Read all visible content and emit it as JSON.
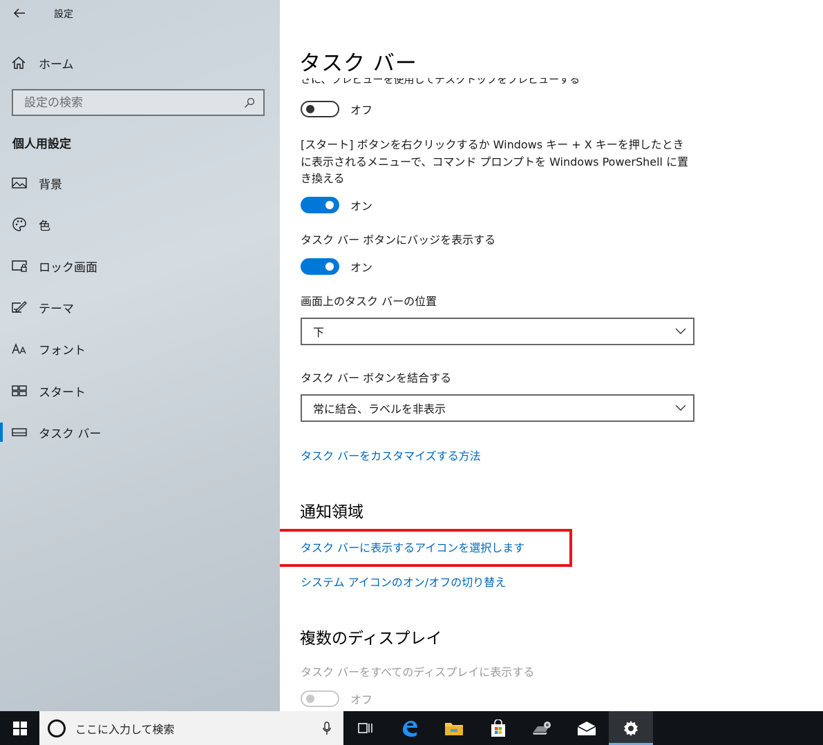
{
  "window": {
    "title": "設定"
  },
  "sidebar": {
    "home_label": "ホーム",
    "search_placeholder": "設定の検索",
    "section_title": "個人用設定",
    "items": [
      {
        "label": "背景",
        "icon": "picture-icon"
      },
      {
        "label": "色",
        "icon": "palette-icon"
      },
      {
        "label": "ロック画面",
        "icon": "lock-screen-icon"
      },
      {
        "label": "テーマ",
        "icon": "theme-icon"
      },
      {
        "label": "フォント",
        "icon": "font-icon"
      },
      {
        "label": "スタート",
        "icon": "start-icon"
      },
      {
        "label": "タスク バー",
        "icon": "taskbar-icon",
        "active": true
      }
    ]
  },
  "main": {
    "title": "タスク バー",
    "cut_text": "さに、プレビューを使用してデスクトップをプレビューする",
    "peek_toggle_state": "オフ",
    "powershell_label": "[スタート] ボタンを右クリックするか Windows キー + X キーを押したときに表示されるメニューで、コマンド プロンプトを Windows PowerShell に置き換える",
    "powershell_state": "オン",
    "badge_label": "タスク バー ボタンにバッジを表示する",
    "badge_state": "オン",
    "position_label": "画面上のタスク バーの位置",
    "position_value": "下",
    "combine_label": "タスク バー ボタンを結合する",
    "combine_value": "常に結合、ラベルを非表示",
    "customize_link": "タスク バーをカスタマイズする方法",
    "notification_heading": "通知領域",
    "select_icons_link": "タスク バーに表示するアイコンを選択します",
    "system_icons_link": "システム アイコンのオン/オフの切り替え",
    "multi_display_heading": "複数のディスプレイ",
    "multi_display_label": "タスク バーをすべてのディスプレイに表示する",
    "multi_display_state": "オフ"
  },
  "taskbar": {
    "search_placeholder": "ここに入力して検索"
  },
  "colors": {
    "accent": "#0078d7",
    "link": "#0067b8",
    "highlight": "#e8141c"
  }
}
